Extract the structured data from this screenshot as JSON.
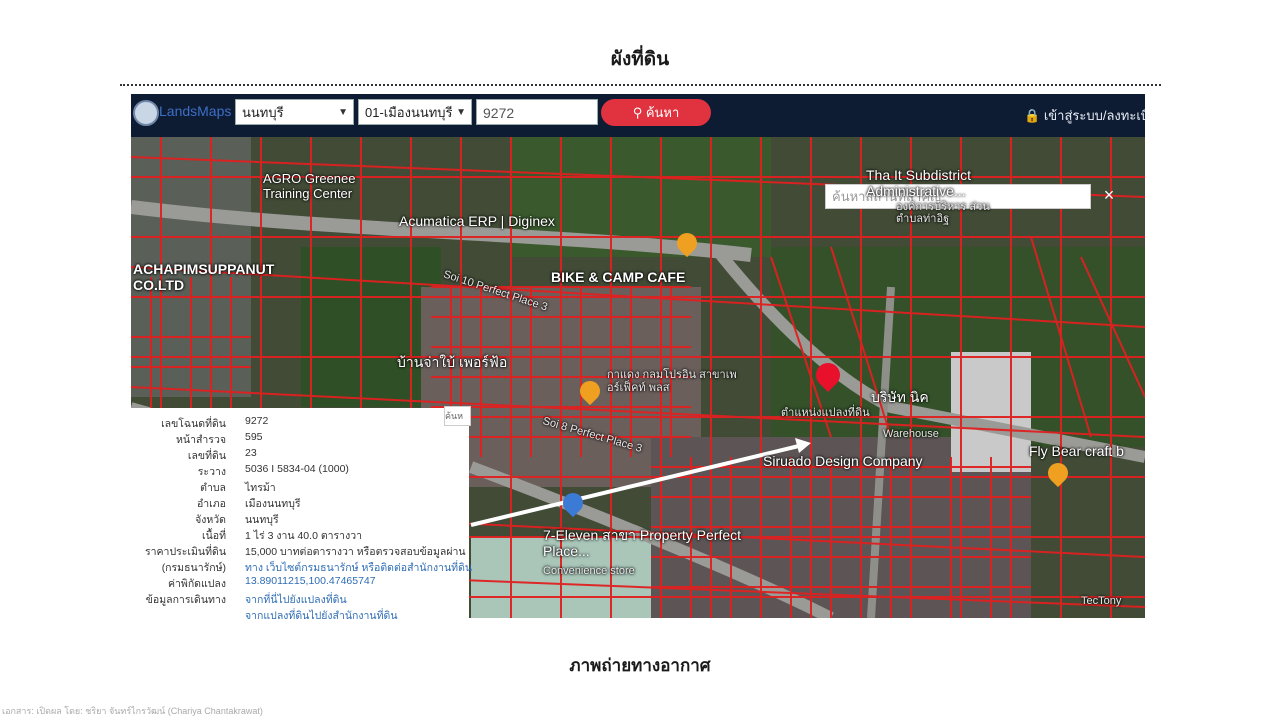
{
  "page_title": "ผังที่ดิน",
  "caption": "ภาพถ่ายทางอากาศ",
  "footer_credit": "เอกสาร: เปิดผล โดย: ชริยา จันทร์ไกรวัฒน์ (Chariya Chantakrawat)",
  "app": {
    "logo_text": "LandsMaps",
    "province_select": "นนทบุรี",
    "district_select": "01-เมืองนนทบุรี",
    "parcel_input": "9272",
    "search_button": "ค้นหา",
    "login_link": "เข้าสู่ระบบ/ลงทะเบีย",
    "place_search_placeholder": "ค้นหาสถานที่สำคัญ",
    "close_symbol": "×",
    "panel_search_stub": "ค้นห"
  },
  "map_labels": {
    "agro": "AGRO Greenee Training Center",
    "acumatica": "Acumatica ERP | Diginex",
    "bike_cafe": "BIKE & CAMP CAFE",
    "achapim": "ACHAPIMSUPPANUT CO.LTD",
    "soi10": "Soi 10 Perfect Place 3",
    "house_th": "บ้านจ่าใบ้ เพอร์ฟ้อ",
    "kamphaeng": "กาแดง กลมโปรอิน สาขาเพอร์เฟ็คท์ พลส",
    "soi8": "Soi 8 Perfect Place 3",
    "thait": "Tha It Subdistrict Administrative...",
    "thait_th": "องค์การบริหาร ส่วนตำบลท่าอิฐ",
    "plot_marker": "ตำแหน่งแปลงที่ดิน",
    "company_th": "บริษัท นิค",
    "warehouse": "Warehouse",
    "siruado": "Siruado Design Company",
    "flybear": "Fly Bear craft b",
    "seven_eleven": "7-Eleven สาขา Property Perfect Place...",
    "convenience": "Convenience store",
    "tectony": "TecTony"
  },
  "colors": {
    "header_bg": "#0d1b33",
    "search_button": "#e0323f",
    "parcel_lines": "#e02020",
    "marker": "#e8102a",
    "link": "#2f6db5"
  },
  "info_panel": {
    "rows": [
      {
        "label": "เลขโฉนดที่ดิน",
        "value": "9272"
      },
      {
        "label": "หน้าสำรวจ",
        "value": "595"
      },
      {
        "label": "เลขที่ดิน",
        "value": "23"
      },
      {
        "label": "ระวาง",
        "value": "5036 I 5834-04 (1000)"
      },
      {
        "label": "ตำบล",
        "value": "ไทรม้า"
      },
      {
        "label": "อำเภอ",
        "value": "เมืองนนทบุรี"
      },
      {
        "label": "จังหวัด",
        "value": "นนทบุรี"
      },
      {
        "label": "เนื้อที่",
        "value": "1 ไร่ 3 งาน 40.0 ตารางวา"
      },
      {
        "label": "ราคาประเมินที่ดิน",
        "value": "15,000 บาทต่อตารางวา หรือตรวจสอบข้อมูลผ่าน"
      },
      {
        "label": "(กรมธนารักษ์)",
        "value": "ทาง เว็บไซต์กรมธนารักษ์ หรือติดต่อสำนักงานที่ดิน"
      },
      {
        "label": "ค่าพิกัดแปลง",
        "value": "13.89011215,100.47465747"
      },
      {
        "label": "ข้อมูลการเดินทาง",
        "value": "จากที่นี่ไปยังแปลงที่ดิน"
      },
      {
        "label": "",
        "value": "จากแปลงที่ดินไปยังสำนักงานที่ดิน"
      }
    ]
  }
}
